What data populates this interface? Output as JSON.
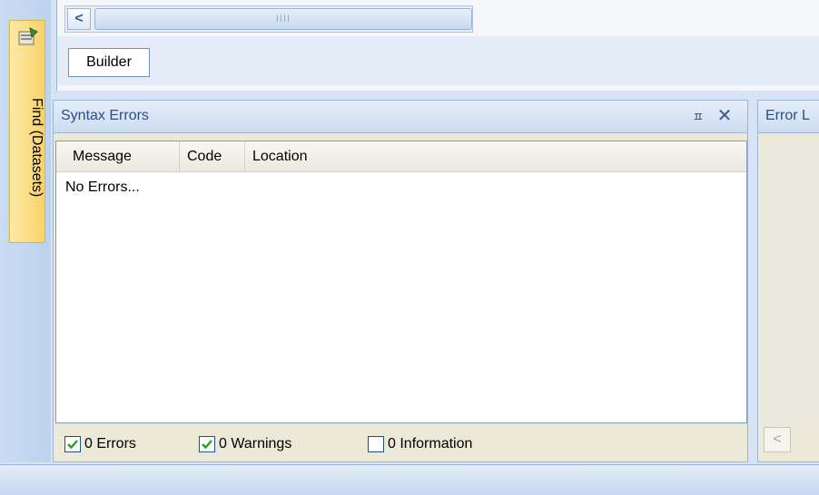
{
  "side_panel": {
    "tab_label": "Find (Datasets)",
    "icon": "find-datasets-icon"
  },
  "top": {
    "scroll_left_glyph": "<",
    "scroll_thumb_grip": "IIII",
    "builder_tab": "Builder"
  },
  "syntax_errors": {
    "title": "Syntax Errors",
    "pin_glyph": "ㅍ",
    "close_glyph": "✕",
    "columns": [
      "Message",
      "Code",
      "Location"
    ],
    "empty_text": "No Errors...",
    "filters": [
      {
        "label": "0 Errors",
        "checked": true
      },
      {
        "label": "0 Warnings",
        "checked": true
      },
      {
        "label": "0 Information",
        "checked": false
      }
    ]
  },
  "error_panel": {
    "title": "Error L",
    "scroll_left_glyph": "<"
  },
  "colors": {
    "accent": "#2b4f86",
    "tab_gold": "#f7d36a",
    "check_green": "#21a121"
  }
}
